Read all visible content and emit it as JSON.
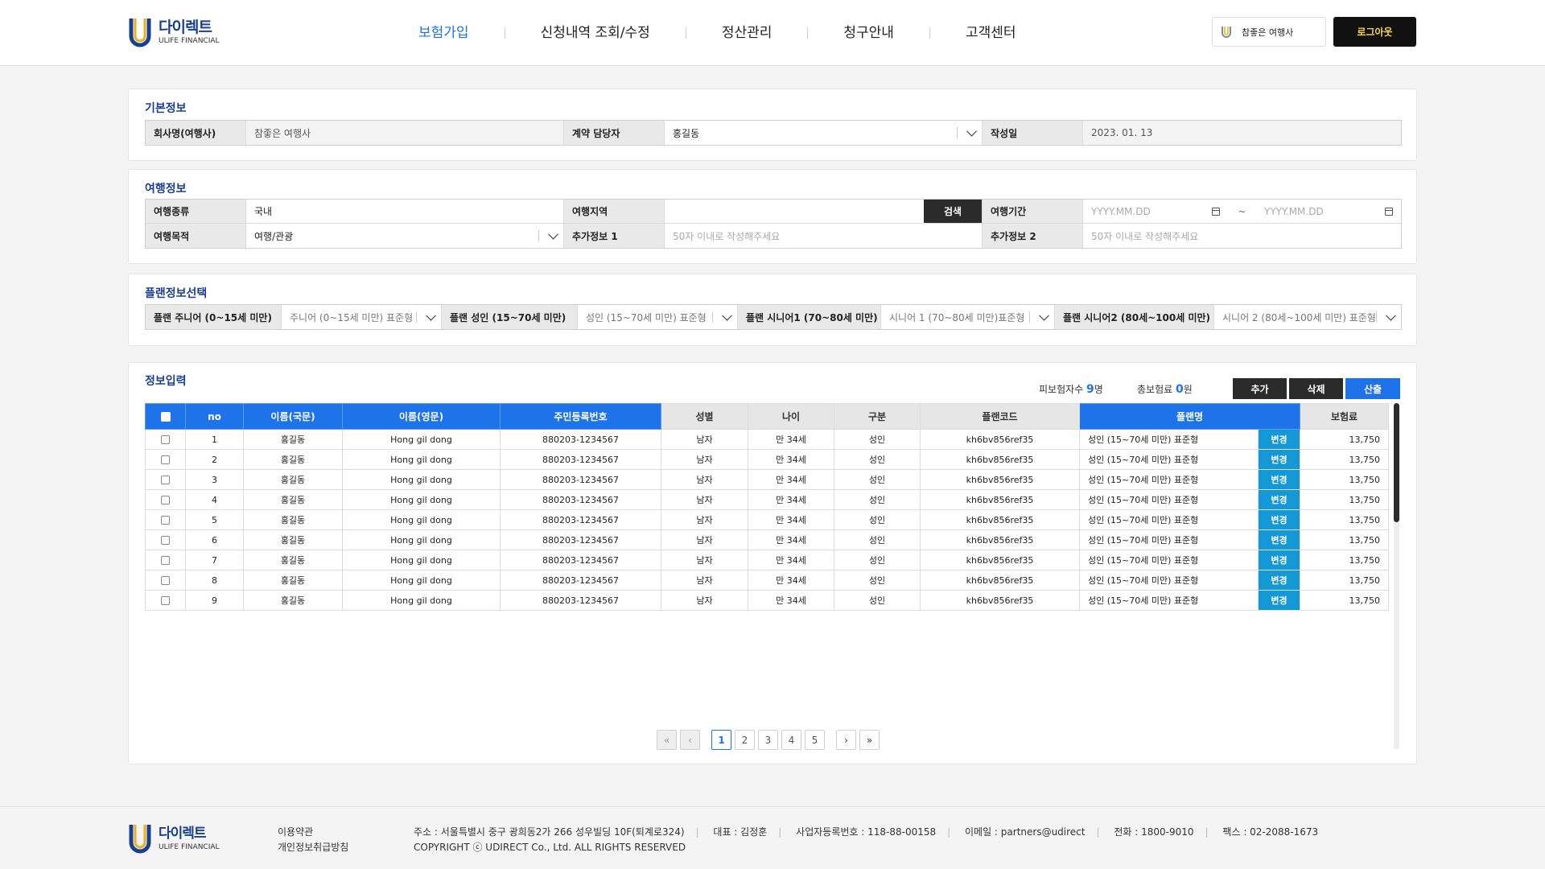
{
  "header": {
    "logo_kr": "다이렉트",
    "logo_en": "ULIFE FINANCIAL",
    "nav": [
      "보험가입",
      "신청내역 조회/수정",
      "정산관리",
      "청구안내",
      "고객센터"
    ],
    "company_name": "참좋은 여행사",
    "logout_label": "로그아웃"
  },
  "basic_info": {
    "title": "기본정보",
    "company_label": "회사명(여행사)",
    "company_value": "참좋은 여행사",
    "manager_label": "계약 담당자",
    "manager_value": "홍길동",
    "date_label": "작성일",
    "date_value": "2023. 01. 13"
  },
  "travel_info": {
    "title": "여행정보",
    "type_label": "여행종류",
    "type_value": "국내",
    "region_label": "여행지역",
    "search_label": "검색",
    "period_label": "여행기간",
    "date_placeholder": "YYYY.MM.DD",
    "tilde": "~",
    "purpose_label": "여행목적",
    "purpose_value": "여행/관광",
    "extra1_label": "추가정보 1",
    "extra2_label": "추가정보 2",
    "extra_placeholder": "50자 이내로 작성해주세요"
  },
  "plan_select": {
    "title": "플랜정보선택",
    "junior_label": "플랜 주니어 (0~15세 미만)",
    "junior_value": "주니어 (0~15세 미만) 표준형",
    "adult_label": "플랜 성인 (15~70세 미만)",
    "adult_value": "성인 (15~70세 미만) 표준형",
    "senior1_label": "플랜 시니어1 (70~80세 미만)",
    "senior1_value": "시니어 1 (70~80세 미만)표준형",
    "senior2_label": "플랜 시니어2 (80세~100세 미만)",
    "senior2_value": "시니어 2 (80세~100세 미만) 표준형"
  },
  "info_input": {
    "title": "정보입력",
    "insured_label": "피보험자수",
    "insured_count": "9",
    "insured_unit": "명",
    "premium_label": "총보험료",
    "premium_total": "0",
    "premium_unit": "원",
    "add_label": "추가",
    "delete_label": "삭제",
    "calc_label": "산출",
    "columns": [
      "no",
      "이름(국문)",
      "이름(영문)",
      "주민등록번호",
      "성별",
      "나이",
      "구분",
      "플랜코드",
      "플랜명",
      "보험료"
    ],
    "change_label": "변경",
    "rows": [
      {
        "no": "1",
        "name_kr": "홍길동",
        "name_en": "Hong gil dong",
        "rrn": "880203-1234567",
        "gender": "남자",
        "age": "만 34세",
        "type": "성인",
        "code": "kh6bv856ref35",
        "plan": "성인 (15~70세 미만) 표준형",
        "premium": "13,750"
      },
      {
        "no": "2",
        "name_kr": "홍길동",
        "name_en": "Hong gil dong",
        "rrn": "880203-1234567",
        "gender": "남자",
        "age": "만 34세",
        "type": "성인",
        "code": "kh6bv856ref35",
        "plan": "성인 (15~70세 미만) 표준형",
        "premium": "13,750"
      },
      {
        "no": "3",
        "name_kr": "홍길동",
        "name_en": "Hong gil dong",
        "rrn": "880203-1234567",
        "gender": "남자",
        "age": "만 34세",
        "type": "성인",
        "code": "kh6bv856ref35",
        "plan": "성인 (15~70세 미만) 표준형",
        "premium": "13,750"
      },
      {
        "no": "4",
        "name_kr": "홍길동",
        "name_en": "Hong gil dong",
        "rrn": "880203-1234567",
        "gender": "남자",
        "age": "만 34세",
        "type": "성인",
        "code": "kh6bv856ref35",
        "plan": "성인 (15~70세 미만) 표준형",
        "premium": "13,750"
      },
      {
        "no": "5",
        "name_kr": "홍길동",
        "name_en": "Hong gil dong",
        "rrn": "880203-1234567",
        "gender": "남자",
        "age": "만 34세",
        "type": "성인",
        "code": "kh6bv856ref35",
        "plan": "성인 (15~70세 미만) 표준형",
        "premium": "13,750"
      },
      {
        "no": "6",
        "name_kr": "홍길동",
        "name_en": "Hong gil dong",
        "rrn": "880203-1234567",
        "gender": "남자",
        "age": "만 34세",
        "type": "성인",
        "code": "kh6bv856ref35",
        "plan": "성인 (15~70세 미만) 표준형",
        "premium": "13,750"
      },
      {
        "no": "7",
        "name_kr": "홍길동",
        "name_en": "Hong gil dong",
        "rrn": "880203-1234567",
        "gender": "남자",
        "age": "만 34세",
        "type": "성인",
        "code": "kh6bv856ref35",
        "plan": "성인 (15~70세 미만) 표준형",
        "premium": "13,750"
      },
      {
        "no": "8",
        "name_kr": "홍길동",
        "name_en": "Hong gil dong",
        "rrn": "880203-1234567",
        "gender": "남자",
        "age": "만 34세",
        "type": "성인",
        "code": "kh6bv856ref35",
        "plan": "성인 (15~70세 미만) 표준형",
        "premium": "13,750"
      },
      {
        "no": "9",
        "name_kr": "홍길동",
        "name_en": "Hong gil dong",
        "rrn": "880203-1234567",
        "gender": "남자",
        "age": "만 34세",
        "type": "성인",
        "code": "kh6bv856ref35",
        "plan": "성인 (15~70세 미만) 표준형",
        "premium": "13,750"
      }
    ],
    "pages": [
      "1",
      "2",
      "3",
      "4",
      "5"
    ]
  },
  "footer": {
    "logo_kr": "다이렉트",
    "logo_en": "ULIFE FINANCIAL",
    "terms": "이용약관",
    "privacy": "개인정보취급방침",
    "address": "주소 : 서울특별시 중구 광희동2가 266 성우빌딩 10F(퇴계로324)",
    "ceo": "대표 : 김정훈",
    "biz_no": "사업자등록번호 : 118-88-00158",
    "email": "이메일 : partners@udirect",
    "phone": "전화 : 1800-9010",
    "fax": "팩스 : 02-2088-1673",
    "copyright": "COPYRIGHT ⓒ UDIRECT Co., Ltd. ALL RIGHTS RESERVED"
  },
  "colors": {
    "accent": "#1e73e8",
    "brand": "#1b3f8f",
    "change_button": "#1498d6",
    "dark": "#2b2b2b"
  }
}
